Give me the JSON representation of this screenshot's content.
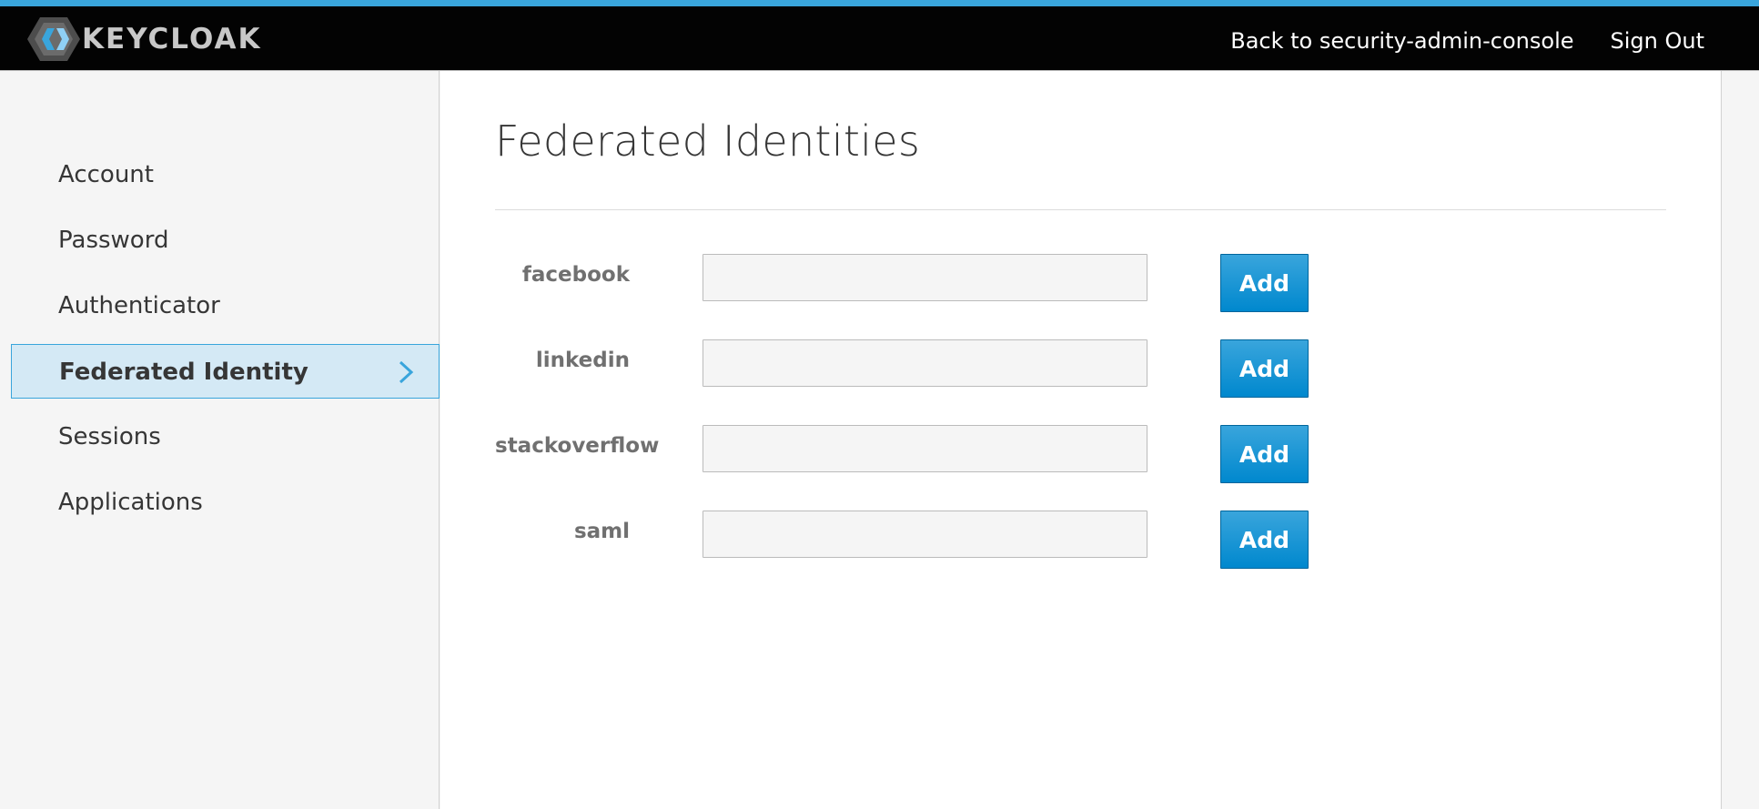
{
  "header": {
    "logo_text": "KEYCLOAK",
    "links": [
      {
        "label": "Back to security-admin-console"
      },
      {
        "label": "Sign Out"
      }
    ]
  },
  "sidebar": {
    "items": [
      {
        "label": "Account"
      },
      {
        "label": "Password"
      },
      {
        "label": "Authenticator"
      },
      {
        "label": "Federated Identity",
        "active": true
      },
      {
        "label": "Sessions"
      },
      {
        "label": "Applications"
      }
    ]
  },
  "main": {
    "title": "Federated Identities",
    "identities": [
      {
        "provider": "facebook",
        "value": "",
        "button": "Add"
      },
      {
        "provider": "linkedin",
        "value": "",
        "button": "Add"
      },
      {
        "provider": "stackoverflow",
        "value": "",
        "button": "Add"
      },
      {
        "provider": "saml",
        "value": "",
        "button": "Add"
      }
    ]
  },
  "colors": {
    "accent": "#39a5dc",
    "button_primary": "#0088ce",
    "active_nav_bg": "#d4e9f5",
    "header_bg": "#030303"
  },
  "icons": {
    "logo": "keycloak-logo-icon",
    "active_nav": "chevron-right-icon"
  }
}
